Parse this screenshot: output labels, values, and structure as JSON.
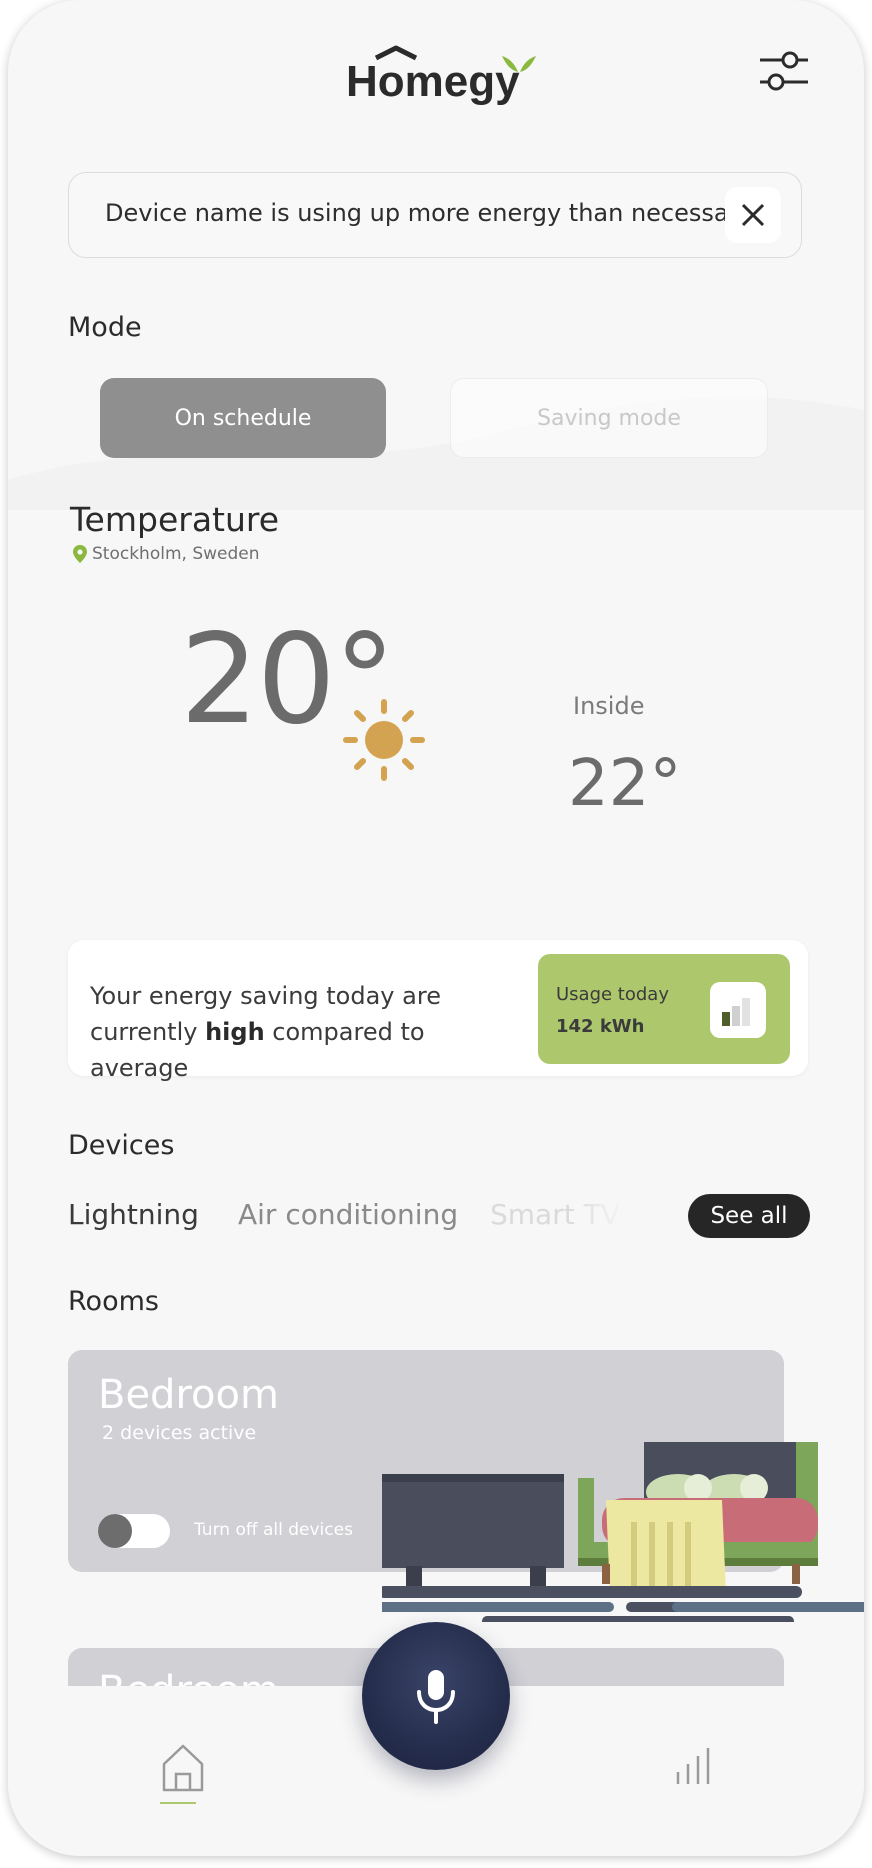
{
  "app": {
    "logo_text": "Hŏmegy",
    "accent_color": "#adc86c"
  },
  "header": {
    "settings_icon": "sliders-icon"
  },
  "alert": {
    "message": "Device name is using up more energy than necessary",
    "close_icon": "close-icon"
  },
  "mode": {
    "title": "Mode",
    "options": [
      {
        "label": "On schedule",
        "selected": true
      },
      {
        "label": "Saving mode",
        "selected": false
      }
    ]
  },
  "temperature": {
    "title": "Temperature",
    "location": "Stockholm, Sweden",
    "outside_value": "20°",
    "weather_icon": "sun-icon",
    "inside_label": "Inside",
    "inside_value": "22°"
  },
  "energy": {
    "text_before": "Your energy saving today are currently ",
    "text_emphasis": "high",
    "text_after": " compared to average",
    "usage_label": "Usage today",
    "usage_value": "142 kWh",
    "usage_icon": "bar-chart-icon"
  },
  "devices": {
    "title": "Devices",
    "tabs": [
      "Lightning",
      "Air conditioning",
      "Smart TV"
    ],
    "see_all_label": "See all"
  },
  "rooms": {
    "title": "Rooms",
    "items": [
      {
        "name": "Bedroom",
        "status": "2 devices active",
        "toggle_label": "Turn off all devices",
        "toggle_on": false
      },
      {
        "name": "Bedroom"
      }
    ]
  },
  "nav": {
    "home_icon": "home-icon",
    "mic_icon": "microphone-icon",
    "stats_icon": "stats-icon"
  }
}
